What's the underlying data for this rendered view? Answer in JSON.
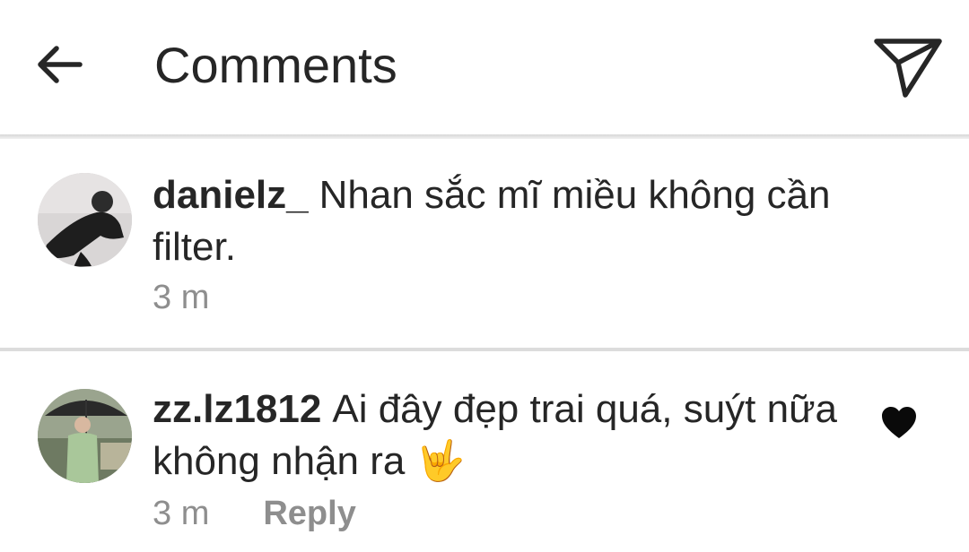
{
  "header": {
    "title": "Comments",
    "back_icon": "arrow-left-icon",
    "send_icon": "paper-plane-icon"
  },
  "comments": [
    {
      "username": "danielz_",
      "text": "Nhan sắc mĩ miều không cần filter.",
      "time": "3 m",
      "avatar_icon": "user-avatar"
    },
    {
      "username": "zz.lz1812",
      "text": "Ai đây đẹp trai quá, suýt nữa không nhận ra 🤟",
      "time": "3 m",
      "reply_label": "Reply",
      "liked": true,
      "like_icon": "heart-filled-icon",
      "avatar_icon": "user-avatar"
    }
  ],
  "colors": {
    "text_primary": "#262626",
    "text_secondary": "#8e8e8e",
    "divider": "#dcdcdc"
  }
}
